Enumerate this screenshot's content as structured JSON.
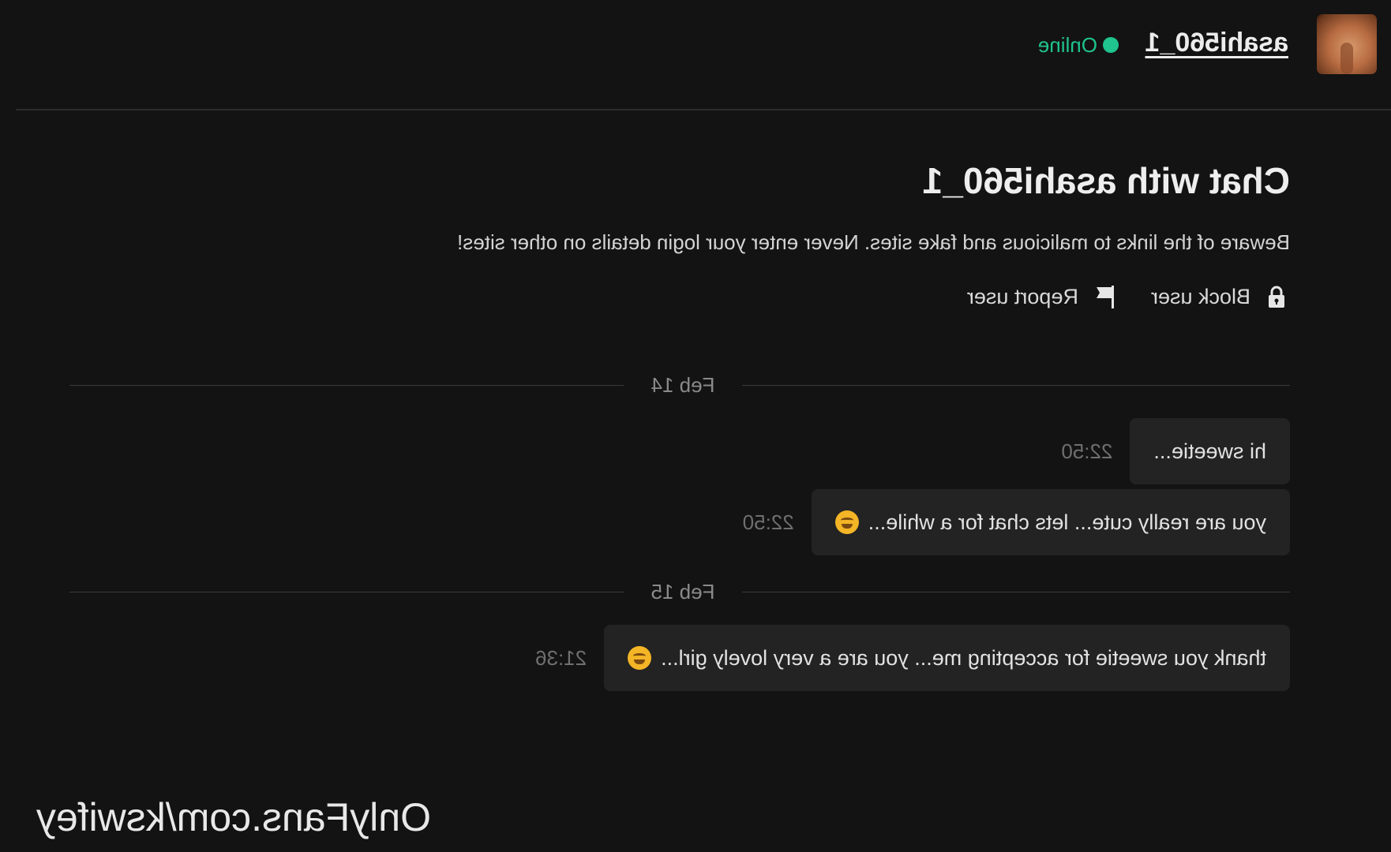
{
  "header": {
    "username": "asahi560_1",
    "status": "Online",
    "status_color": "#1fc48e"
  },
  "chat": {
    "title": "Chat with asahi560_1",
    "warning": "Beware of the links to malicious and fake sites. Never enter your login details on other sites!",
    "actions": {
      "block_label": "Block user",
      "block_icon": "lock-icon",
      "report_label": "Report user",
      "report_icon": "flag-icon"
    }
  },
  "dividers": [
    "Feb 14",
    "Feb 15"
  ],
  "messages": [
    {
      "text": "hi sweetie...",
      "time": "22:50",
      "emoji": null
    },
    {
      "text": "you are really cute... lets chat for a while...",
      "time": "22:50",
      "emoji": "smirk-face-emoji"
    },
    {
      "text": "thank you sweetie for accepting me... you are a very lovely girl...",
      "time": "21:36",
      "emoji": "grinning-face-emoji"
    }
  ],
  "watermark": "OnlyFans.com/kswifey",
  "accent_color": "#1fc48e"
}
